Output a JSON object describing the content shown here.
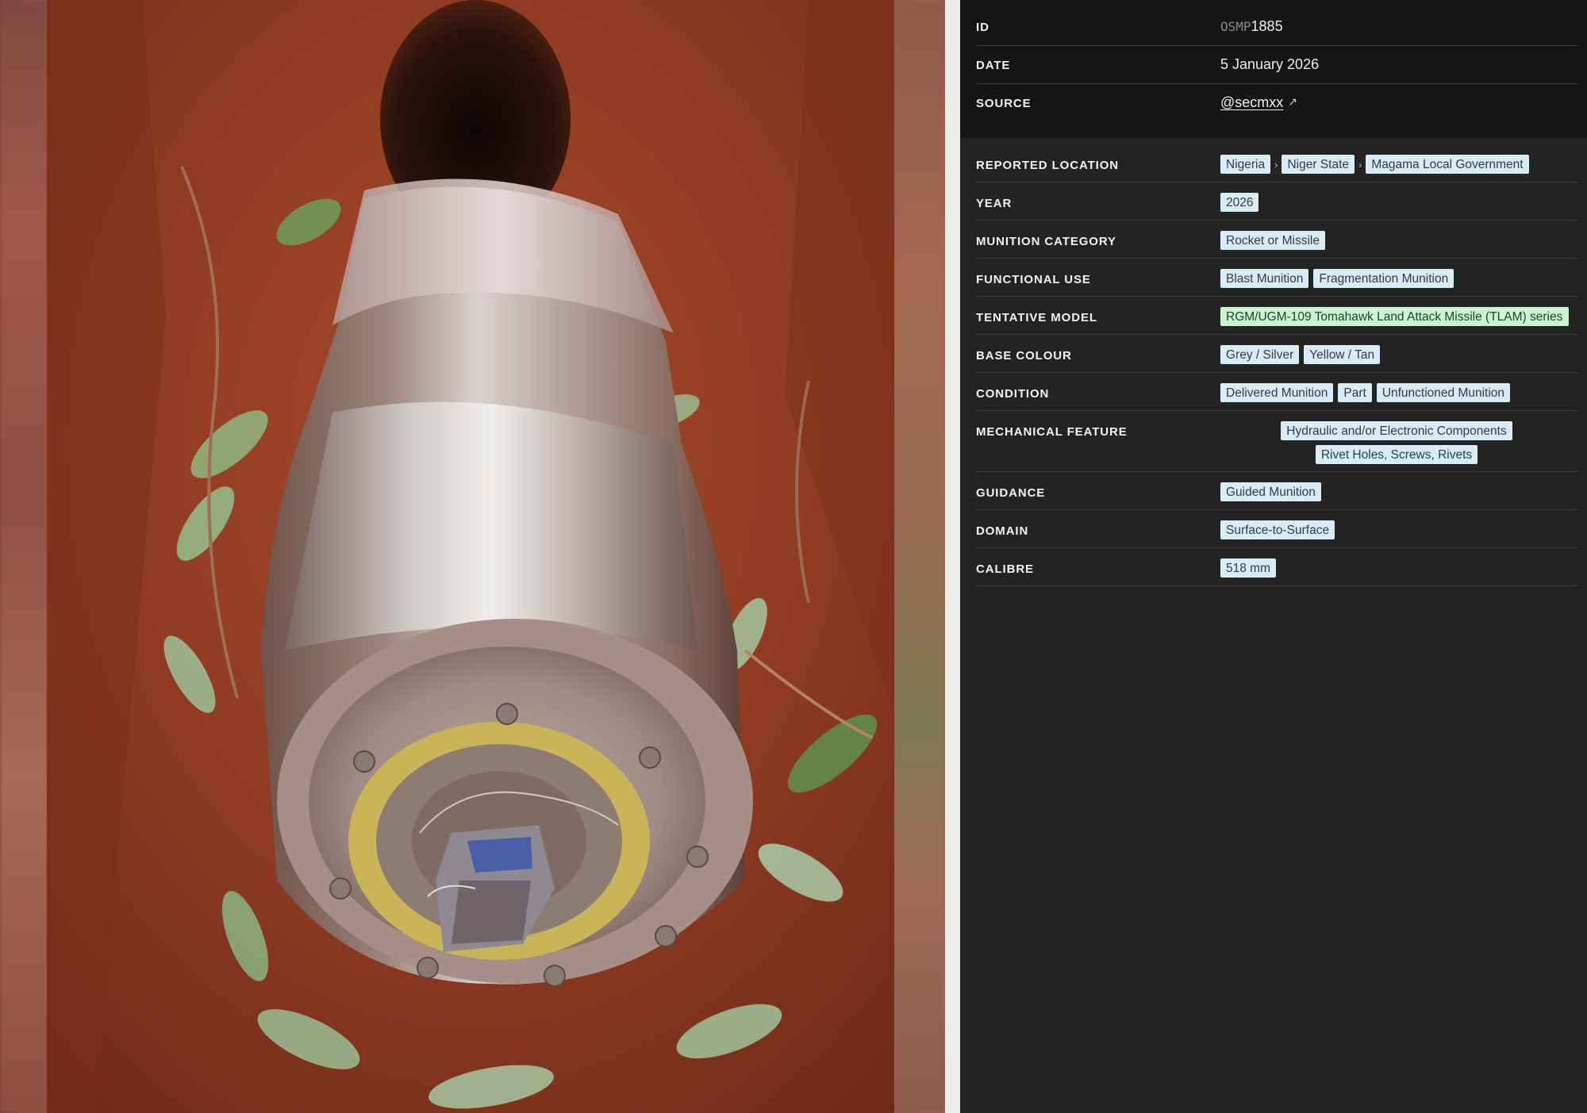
{
  "viewer": {
    "photo_icon": "munition-photo"
  },
  "record": {
    "id_label": "ID",
    "id_prefix": "OSMP",
    "id_number": "1885",
    "date_label": "DATE",
    "date_value": "5 January 2026",
    "source_label": "SOURCE",
    "source_value": "@secmxx",
    "source_icon": "external-link-icon"
  },
  "fields": {
    "reported_location": {
      "label": "REPORTED LOCATION",
      "tags": [
        "Nigeria",
        "Niger State",
        "Magama Local Government"
      ],
      "separator": "›"
    },
    "year": {
      "label": "YEAR",
      "tags": [
        "2026"
      ]
    },
    "munition_category": {
      "label": "MUNITION CATEGORY",
      "tags": [
        "Rocket or Missile"
      ]
    },
    "functional_use": {
      "label": "FUNCTIONAL USE",
      "tags": [
        "Blast Munition",
        "Fragmentation Munition"
      ]
    },
    "tentative_model": {
      "label": "TENTATIVE MODEL",
      "tags": [
        "RGM/UGM-109 Tomahawk Land Attack Missile (TLAM) series"
      ]
    },
    "base_colour": {
      "label": "BASE COLOUR",
      "tags": [
        "Grey / Silver",
        "Yellow / Tan"
      ]
    },
    "condition": {
      "label": "CONDITION",
      "tags": [
        "Delivered Munition",
        "Part",
        "Unfunctioned Munition"
      ]
    },
    "mechanical_feature": {
      "label": "MECHANICAL FEATURE",
      "tags": [
        "Hydraulic and/or Electronic Components",
        "Rivet Holes, Screws, Rivets"
      ]
    },
    "guidance": {
      "label": "GUIDANCE",
      "tags": [
        "Guided Munition"
      ]
    },
    "domain": {
      "label": "DOMAIN",
      "tags": [
        "Surface-to-Surface"
      ]
    },
    "calibre": {
      "label": "CALIBRE",
      "tags": [
        "518 mm"
      ]
    }
  },
  "colors": {
    "panel_bg": "#232323",
    "id_block_bg": "#151515",
    "tag_blue": "#d7ecf5",
    "tag_green": "#ccf5cf",
    "divider": "#3c3c3c",
    "gutter": "#ececec"
  }
}
